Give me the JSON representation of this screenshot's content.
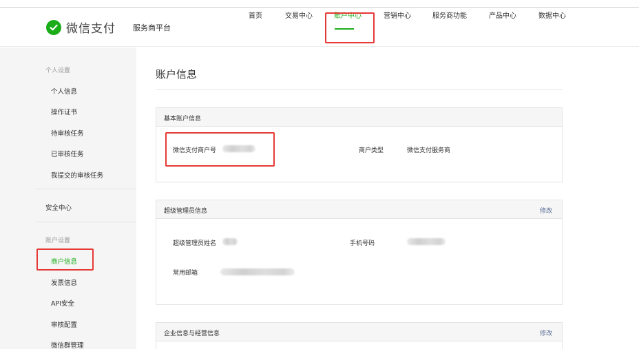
{
  "header": {
    "brand": "微信支付",
    "platform": "服务商平台",
    "nav": [
      {
        "label": "首页"
      },
      {
        "label": "交易中心"
      },
      {
        "label": "账户中心"
      },
      {
        "label": "营销中心"
      },
      {
        "label": "服务商功能"
      },
      {
        "label": "产品中心"
      },
      {
        "label": "数据中心"
      }
    ],
    "active_nav": "账户中心"
  },
  "sidebar": {
    "group1": "个人设置",
    "group1_items": [
      "个人信息",
      "操作证书",
      "待审核任务",
      "已审核任务",
      "我提交的审核任务"
    ],
    "security": "安全中心",
    "group2": "账户设置",
    "group2_items": [
      "商户信息",
      "发票信息",
      "API安全",
      "审核配置",
      "微信群管理"
    ],
    "active_item": "商户信息"
  },
  "main": {
    "title": "账户信息",
    "basic": {
      "title": "基本账户信息",
      "merchant_id_label": "微信支付商户号",
      "merchant_type_label": "商户类型",
      "merchant_type_value": "微信支付服务商"
    },
    "admin": {
      "title": "超级管理员信息",
      "edit": "修改",
      "name_label": "超级管理员姓名",
      "phone_label": "手机号码",
      "email_label": "常用邮箱"
    },
    "enterprise": {
      "title": "企业信息与经营信息",
      "edit": "修改"
    }
  },
  "colors": {
    "brand_green": "#1aad19",
    "highlight_red": "#e53935",
    "link_blue": "#576b95"
  }
}
